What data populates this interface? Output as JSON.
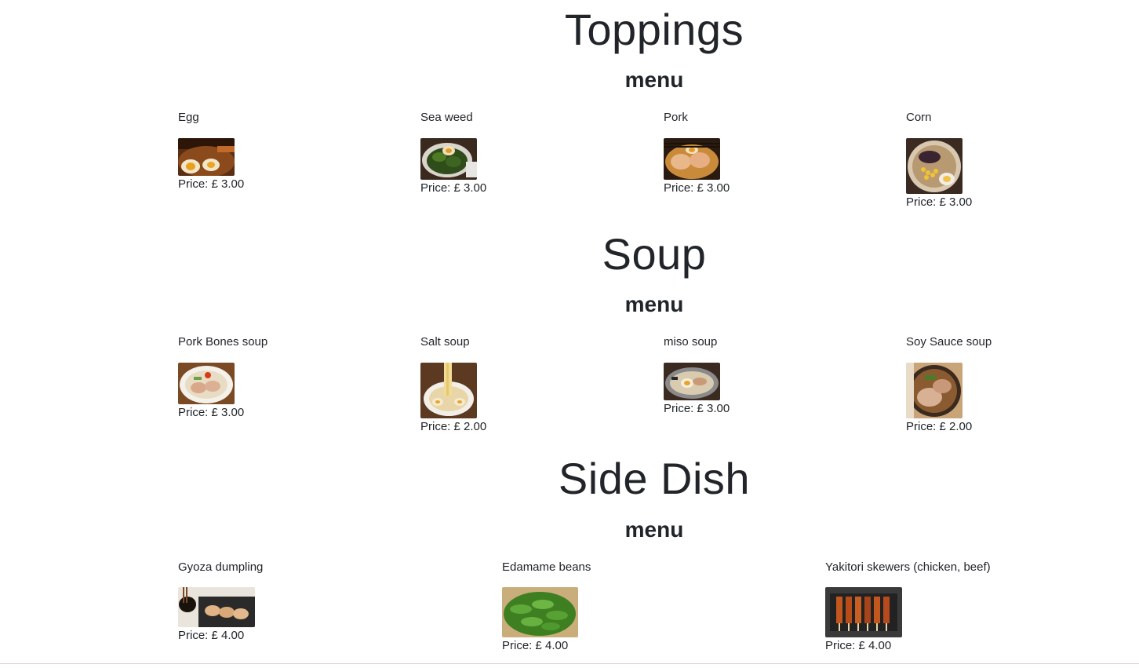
{
  "sections": [
    {
      "title": "Toppings",
      "subtitle": "menu",
      "items": [
        {
          "name": "Egg",
          "price_label": "Price: £ 3.00",
          "photo": "egg-ramen-photo"
        },
        {
          "name": "Sea weed",
          "price_label": "Price: £ 3.00",
          "photo": "seaweed-ramen-photo"
        },
        {
          "name": "Pork",
          "price_label": "Price: £ 3.00",
          "photo": "pork-ramen-photo"
        },
        {
          "name": "Corn",
          "price_label": "Price: £ 3.00",
          "photo": "corn-ramen-photo"
        }
      ]
    },
    {
      "title": "Soup",
      "subtitle": "menu",
      "items": [
        {
          "name": "Pork Bones soup",
          "price_label": "Price: £ 3.00",
          "photo": "pork-bones-soup-photo"
        },
        {
          "name": "Salt soup",
          "price_label": "Price: £ 2.00",
          "photo": "salt-soup-photo"
        },
        {
          "name": "miso soup",
          "price_label": "Price: £ 3.00",
          "photo": "miso-soup-photo"
        },
        {
          "name": "Soy Sauce soup",
          "price_label": "Price: £ 2.00",
          "photo": "soy-sauce-soup-photo"
        }
      ]
    },
    {
      "title": "Side Dish",
      "subtitle": "menu",
      "items": [
        {
          "name": "Gyoza dumpling",
          "price_label": "Price: £ 4.00",
          "photo": "gyoza-photo"
        },
        {
          "name": "Edamame beans",
          "price_label": "Price: £ 4.00",
          "photo": "edamame-photo"
        },
        {
          "name": "Yakitori skewers (chicken, beef)",
          "price_label": "Price: £ 4.00",
          "photo": "yakitori-photo"
        }
      ]
    }
  ]
}
